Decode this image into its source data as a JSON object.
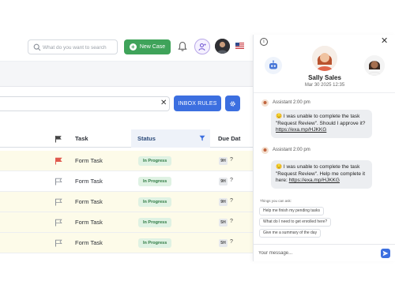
{
  "topbar": {
    "search_placeholder": "What do you want to search",
    "new_case_label": "New Case"
  },
  "toolbar": {
    "inbox_rules_label": "INBOX RULES"
  },
  "table": {
    "columns": {
      "task": "Task",
      "status": "Status",
      "due": "Due Dat"
    },
    "rows": [
      {
        "task": "Form Task",
        "status": "In Progress",
        "due_badge": "9H",
        "due_extra": "?",
        "flag": "red",
        "highlight": true
      },
      {
        "task": "Form Task",
        "status": "In Progress",
        "due_badge": "9H",
        "due_extra": "?",
        "flag": "gray",
        "highlight": false
      },
      {
        "task": "Form Task",
        "status": "In Progress",
        "due_badge": "9H",
        "due_extra": "?",
        "flag": "gray",
        "highlight": true
      },
      {
        "task": "Form Task",
        "status": "In Progress",
        "due_badge": "5H",
        "due_extra": "?",
        "flag": "gray",
        "highlight": true
      },
      {
        "task": "Form Task",
        "status": "In Progress",
        "due_badge": "5H",
        "due_extra": "?",
        "flag": "gray",
        "highlight": true
      }
    ]
  },
  "assistant": {
    "agent_name": "Sally Sales",
    "agent_date": "Mar 30 2025 12:35",
    "messages": [
      {
        "sender": "Assistant 2:00 pm",
        "text": "I was unable to complete the task \"Request Review\". Should I approve it?",
        "link": "https://exa.mp/HJKKG"
      },
      {
        "sender": "Assistant 2:00 pm",
        "text": "I was unable to complete the task \"Request Review\". Help me complete it here:",
        "link": "https://exa.mp/HJKKG"
      }
    ],
    "suggestions_title": "Things you can ask:",
    "suggestions": [
      "Help me finish my pending tasks",
      "What do I need to get enrolled here?",
      "Give me a summary of the day"
    ],
    "composer_placeholder": "Your message..."
  },
  "colors": {
    "primary": "#3c6fe0",
    "success": "#3fa35a",
    "flag_red": "#e05a4f",
    "row_highlight": "#fdfbe9"
  },
  "icons": {
    "search": "search-icon",
    "bell": "bell-icon",
    "gear": "gear-icon",
    "filter": "filter-icon",
    "send": "send-icon"
  }
}
